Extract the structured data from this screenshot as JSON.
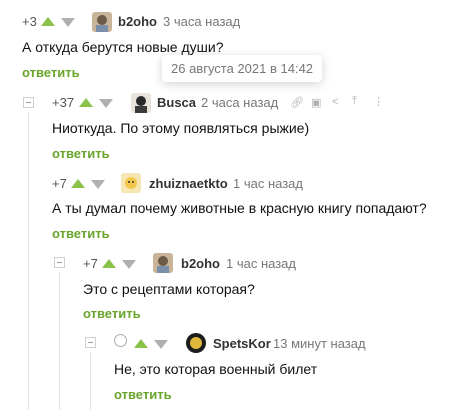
{
  "colors": {
    "accent_green": "#69a42c",
    "up_arrow": "#8bc34a",
    "down_arrow": "#b0b0b0"
  },
  "tooltip": {
    "text": "26 августа 2021 в 14:42"
  },
  "comments": [
    {
      "rating": "+3",
      "author": "b2oho",
      "time": "3 часа назад",
      "text": "А откуда берутся новые души?",
      "reply": "ответить"
    },
    {
      "rating": "+37",
      "author": "Busca",
      "time": "2 часа назад",
      "text": "Ниоткуда. По этому появляться рыжие)",
      "reply": "ответить",
      "actions": [
        "link-icon",
        "save-icon",
        "share-icon",
        "scroll-up-icon",
        "more-icon"
      ]
    },
    {
      "rating": "+7",
      "author": "zhuiznaetkto",
      "time": "1 час назад",
      "text": "А ты думал почему животные в красную книгу попадают?",
      "reply": "ответить"
    },
    {
      "rating": "+7",
      "author": "b2oho",
      "time": "1 час назад",
      "text": "Это с рецептами которая?",
      "reply": "ответить"
    },
    {
      "rating": "",
      "author": "SpetsKor",
      "time": "13 минут назад",
      "text": "Не, это которая военный билет",
      "reply": "ответить"
    }
  ]
}
